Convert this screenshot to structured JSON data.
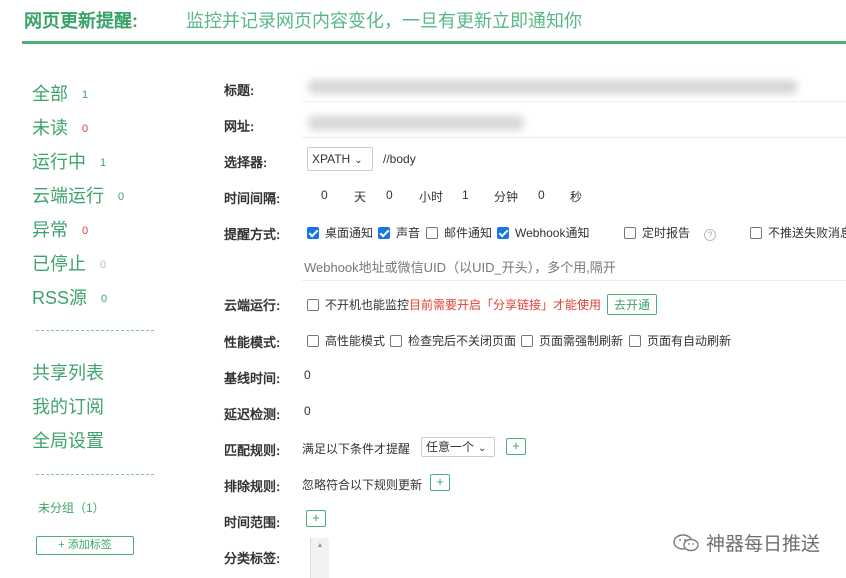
{
  "header": {
    "brand": "网页更新提醒:",
    "tagline": "监控并记录网页内容变化，一旦有更新立即通知你"
  },
  "sidebar": {
    "filters": [
      {
        "label": "全部",
        "count": "1",
        "color": "#3fa36c"
      },
      {
        "label": "未读",
        "count": "0",
        "color": "#e0403a"
      },
      {
        "label": "运行中",
        "count": "1",
        "color": "#3fa36c"
      },
      {
        "label": "云端运行",
        "count": "0",
        "color": "#3fa36c"
      },
      {
        "label": "异常",
        "count": "0",
        "color": "#e0403a"
      },
      {
        "label": "已停止",
        "count": "0",
        "color": "#bbbbbb"
      },
      {
        "label": "RSS源",
        "count": "0",
        "color": "#3fa36c"
      }
    ],
    "links": [
      "共享列表",
      "我的订阅",
      "全局设置"
    ],
    "group": "未分组（1）",
    "add_tag": "+ 添加标签"
  },
  "form": {
    "title_label": "标题:",
    "url_label": "网址:",
    "selector": {
      "label": "选择器:",
      "type": "XPATH",
      "value": "//body"
    },
    "interval": {
      "label": "时间间隔:",
      "days": "0",
      "days_unit": "天",
      "hours": "0",
      "hours_unit": "小时",
      "minutes": "1",
      "minutes_unit": "分钟",
      "seconds": "0",
      "seconds_unit": "秒"
    },
    "notify": {
      "label": "提醒方式:",
      "options": [
        {
          "label": "桌面通知",
          "checked": true
        },
        {
          "label": "声音",
          "checked": true
        },
        {
          "label": "邮件通知",
          "checked": false
        },
        {
          "label": "Webhook通知",
          "checked": true
        },
        {
          "label": "定时报告",
          "checked": false
        },
        {
          "label": "不推送失败消息",
          "checked": false
        }
      ],
      "webhook_placeholder": "Webhook地址或微信UID（以UID_开头），多个用,隔开"
    },
    "cloud": {
      "label": "云端运行:",
      "text": "不开机也能监控",
      "warning": "目前需要开启「分享链接」才能使用",
      "button": "去开通"
    },
    "performance": {
      "label": "性能模式:",
      "options": [
        "高性能模式",
        "检查完后不关闭页面",
        "页面需强制刷新",
        "页面有自动刷新"
      ]
    },
    "baseline": {
      "label": "基线时间:",
      "value": "0"
    },
    "delay": {
      "label": "延迟检测:",
      "value": "0"
    },
    "match": {
      "label": "匹配规则:",
      "text": "满足以下条件才提醒",
      "select": "任意一个",
      "add": "+"
    },
    "exclude": {
      "label": "排除规则:",
      "text": "忽略符合以下规则更新",
      "add": "+"
    },
    "time_range": {
      "label": "时间范围:",
      "add": "+"
    },
    "category": {
      "label": "分类标签:"
    }
  },
  "watermark": "神器每日推送"
}
